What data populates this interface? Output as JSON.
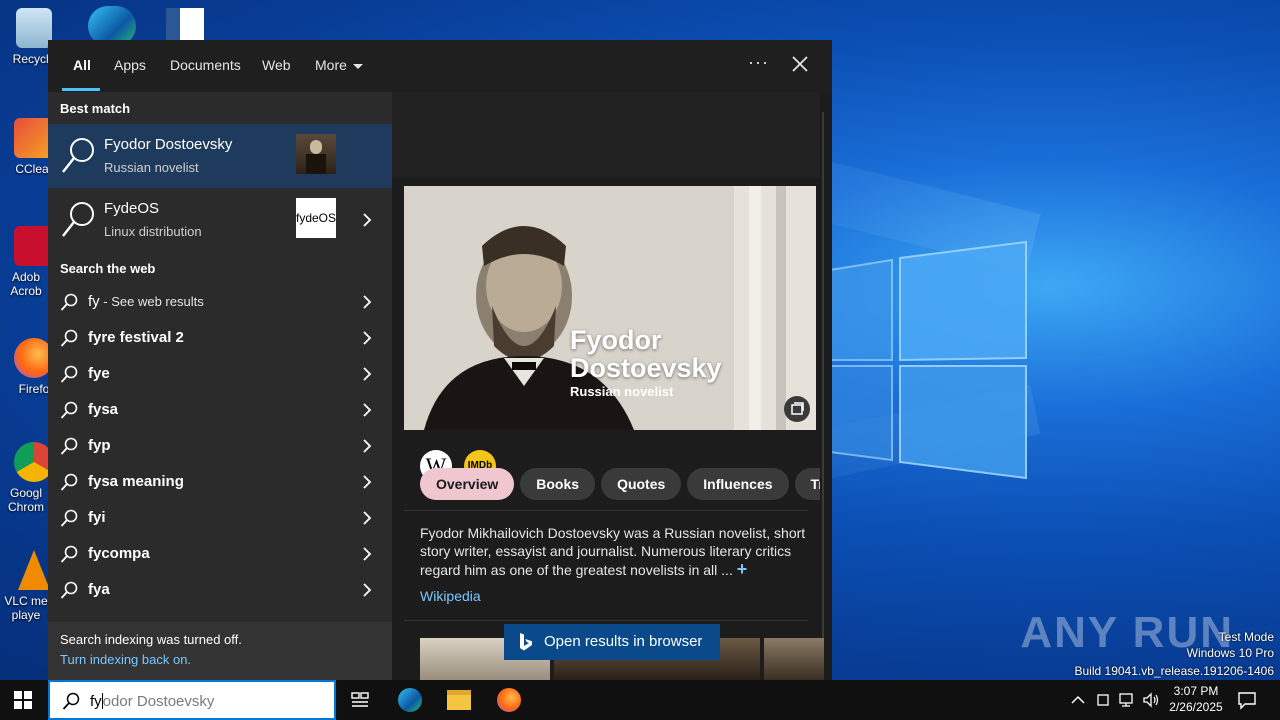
{
  "desktop": {
    "icons": [
      {
        "label": "Recycle"
      },
      {
        "label": "CClear"
      },
      {
        "label": "Adob Acrob"
      },
      {
        "label": "Firefo"
      },
      {
        "label": "Googl Chrom"
      },
      {
        "label": "VLC me playe"
      }
    ],
    "watermark": {
      "logo_text": "ANY RUN",
      "line1": "Test Mode",
      "line2": "Windows 10 Pro",
      "line3": "Build 19041.vb_release.191206-1406"
    }
  },
  "search_panel": {
    "tabs": [
      "All",
      "Apps",
      "Documents",
      "Web",
      "More"
    ],
    "best_match_heading": "Best match",
    "results": [
      {
        "title": "Fyodor Dostoevsky",
        "subtitle": "Russian novelist"
      },
      {
        "title": "FydeOS",
        "subtitle": "Linux distribution",
        "thumb_text": "fydeOS"
      }
    ],
    "web_heading": "Search the web",
    "web_first": {
      "query": "fy",
      "hint": " - See web results"
    },
    "web_suggestions": [
      "fyre festival 2",
      "fye",
      "fysa",
      "fyp",
      "fysa meaning",
      "fyi",
      "fycompa",
      "fya"
    ],
    "footer": {
      "status": "Search indexing was turned off.",
      "link": "Turn indexing back on."
    }
  },
  "detail": {
    "name": "Fyodor Dostoevsky",
    "subtitle": "Russian novelist",
    "wiki_badge": "W",
    "imdb_badge": "IMDb",
    "pills": [
      "Overview",
      "Books",
      "Quotes",
      "Influences",
      "Triv"
    ],
    "description": "Fyodor Mikhailovich Dostoevsky was a Russian novelist, short story writer, essayist and journalist. Numerous literary critics regard him as one of the greatest novelists in all ...",
    "more_symbol": "+",
    "source": "Wikipedia",
    "open_browser": "Open results in browser"
  },
  "taskbar": {
    "typed": "fy",
    "autocomplete": "odor Dostoevsky",
    "time": "3:07 PM",
    "date": "2/26/2025"
  },
  "colors": {
    "accent": "#4cc2ff",
    "selected_row": "#1e3a5c",
    "pill_active": "#f0c6cf",
    "link": "#7cc7ff"
  }
}
